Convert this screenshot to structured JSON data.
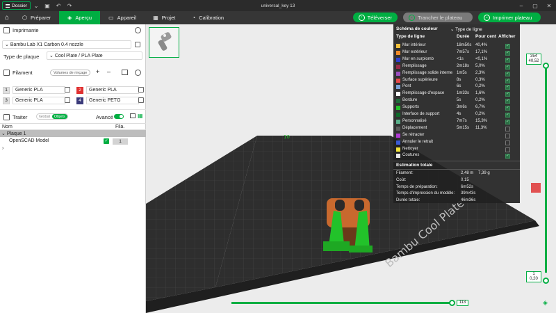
{
  "titlebar": {
    "menu_label": "Dossier",
    "window_title": "universal_key 13"
  },
  "tabs": [
    {
      "label": "Préparer",
      "icon": "cube-icon"
    },
    {
      "label": "Aperçu",
      "icon": "layers-icon"
    },
    {
      "label": "Appareil",
      "icon": "monitor-icon"
    },
    {
      "label": "Projet",
      "icon": "grid-icon"
    },
    {
      "label": "Calibration",
      "icon": "gauge-icon"
    }
  ],
  "actions": {
    "upload": "Téléverser",
    "slice": "Trancher le plateau",
    "print": "Imprimer plateau"
  },
  "printer": {
    "section": "Imprimante",
    "model": "Bambu Lab X1 Carbon 0.4 nozzle",
    "plate_type_label": "Type de plaque",
    "plate_type": "Cool Plate / PLA Plate"
  },
  "filament": {
    "section": "Filament",
    "flush_button": "Volumes de rinçage",
    "items": [
      {
        "num": "1",
        "name": "Generic PLA",
        "color": "#f2f2f2",
        "num_color": "#222"
      },
      {
        "num": "2",
        "name": "Generic PLA",
        "color": "#e03030",
        "num_color": "#fff"
      },
      {
        "num": "3",
        "name": "Generic PLA",
        "color": "#f2f2f2",
        "num_color": "#222"
      },
      {
        "num": "4",
        "name": "Generic PETG",
        "color": "#3a3a7a",
        "num_color": "#fff"
      }
    ]
  },
  "process": {
    "section": "Traiter",
    "seg": [
      "Global",
      "Objets"
    ],
    "advanced": "Avancé"
  },
  "objects": {
    "col_name": "Nom",
    "col_fil": "Fila.",
    "plate": "Plaque 1",
    "object_name": "OpenSCAD Model",
    "object_filament": "1"
  },
  "legend": {
    "title": "Schéma de couleur",
    "select": "Type de ligne",
    "headers": {
      "type": "Type de ligne",
      "duration": "Durée",
      "percent": "Pour cent",
      "show": "Afficher"
    },
    "rows": [
      {
        "name": "Mur intérieur",
        "color": "#f2c13a",
        "duration": "18m50s",
        "percent": "40,4%",
        "show": true
      },
      {
        "name": "Mur extérieur",
        "color": "#f28c28",
        "duration": "7m57s",
        "percent": "17,1%",
        "show": true
      },
      {
        "name": "Mur en surplomb",
        "color": "#2f3fd1",
        "duration": "<1s",
        "percent": "<0,1%",
        "show": true
      },
      {
        "name": "Remplissage",
        "color": "#9a2b4a",
        "duration": "2m18s",
        "percent": "5,0%",
        "show": true
      },
      {
        "name": "Remplissage solide interne",
        "color": "#9b4ec0",
        "duration": "1m5s",
        "percent": "2,3%",
        "show": true
      },
      {
        "name": "Surface supérieure",
        "color": "#e84a4a",
        "duration": "8s",
        "percent": "0,3%",
        "show": true
      },
      {
        "name": "Pont",
        "color": "#7aa3d8",
        "duration": "6s",
        "percent": "0,2%",
        "show": true
      },
      {
        "name": "Remplissage d'espace",
        "color": "#ffffff",
        "duration": "1m33s",
        "percent": "1,6%",
        "show": true
      },
      {
        "name": "Bordure",
        "color": "#1e6b3a",
        "duration": "5s",
        "percent": "0,2%",
        "show": true
      },
      {
        "name": "Supports",
        "color": "#22c22a",
        "duration": "3m6s",
        "percent": "6,7%",
        "show": true
      },
      {
        "name": "Interface de support",
        "color": "#0d6a2a",
        "duration": "4s",
        "percent": "0,2%",
        "show": true
      },
      {
        "name": "Personnalisé",
        "color": "#59b08a",
        "duration": "7m7s",
        "percent": "15,3%",
        "show": true
      },
      {
        "name": "Déplacement",
        "color": "#5a5a5a",
        "duration": "5m15s",
        "percent": "11,3%",
        "show": false
      },
      {
        "name": "Se rétracter",
        "color": "#b23ad6",
        "duration": "",
        "percent": "",
        "show": false
      },
      {
        "name": "Annuler le retrait",
        "color": "#3a5ad6",
        "duration": "",
        "percent": "",
        "show": false
      },
      {
        "name": "Nettoyer",
        "color": "#f2e43a",
        "duration": "",
        "percent": "",
        "show": false
      },
      {
        "name": "Coutures",
        "color": "#e8e8e8",
        "duration": "",
        "percent": "",
        "show": true
      }
    ],
    "estimate": {
      "title": "Estimation totale",
      "rows": [
        {
          "k": "Filament:",
          "v": "2,48 m",
          "v2": "7,39 g"
        },
        {
          "k": "Coût:",
          "v": "0,15",
          "v2": ""
        },
        {
          "k": "Temps de préparation:",
          "v": "6m52s",
          "v2": ""
        },
        {
          "k": "Temps d'impression du modèle:",
          "v": "39m43s",
          "v2": ""
        },
        {
          "k": "Durée totale:",
          "v": "46m36s",
          "v2": ""
        }
      ]
    }
  },
  "vslider": {
    "top_layer": "354",
    "top_height": "40,52",
    "bottom_layer": "1",
    "bottom_height": "0,20"
  },
  "hslider": {
    "value": "113"
  },
  "plate_text": "Bambu Cool Plate"
}
